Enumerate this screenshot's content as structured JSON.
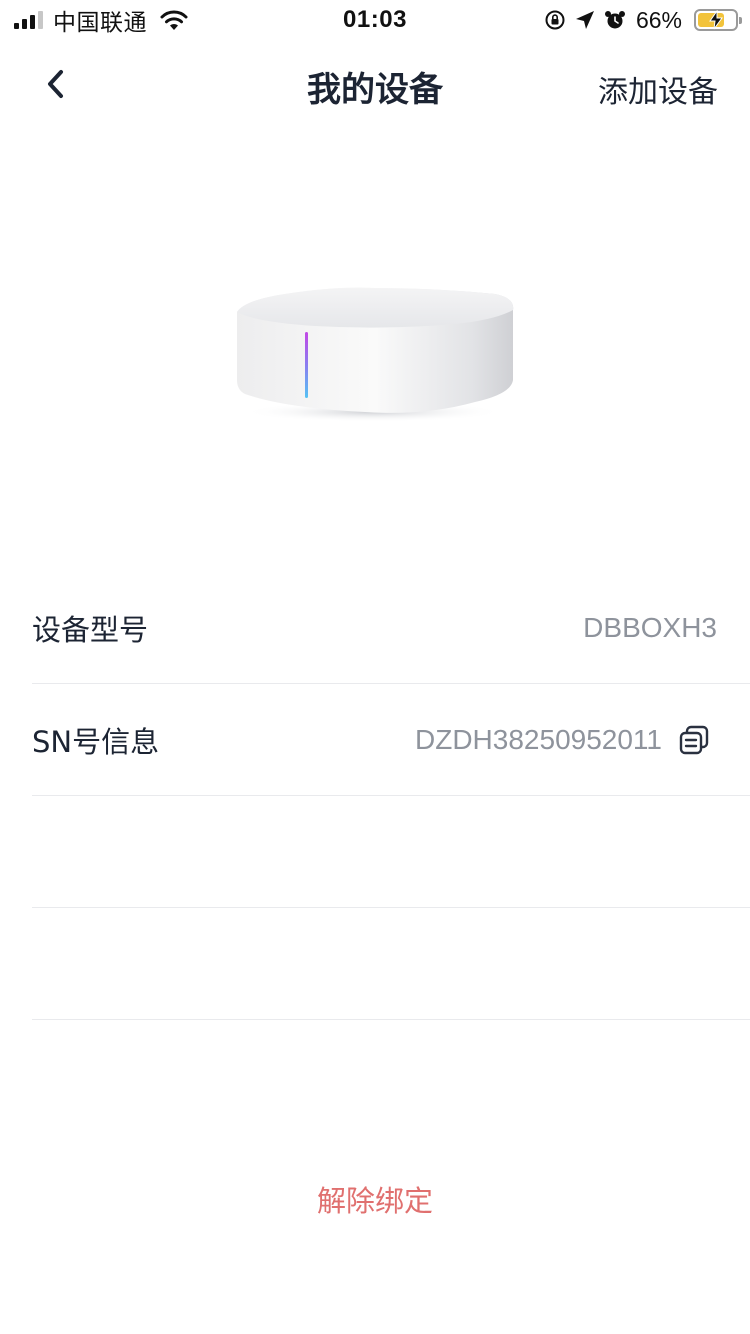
{
  "status_bar": {
    "carrier": "中国联通",
    "time": "01:03",
    "battery_percent": "66%",
    "icons": [
      "signal-icon",
      "wifi-icon",
      "orientation-lock-icon",
      "location-icon",
      "alarm-icon",
      "battery-charging-icon"
    ]
  },
  "nav": {
    "back_icon": "chevron-left-icon",
    "title": "我的设备",
    "add_device": "添加设备"
  },
  "device": {
    "image": "smart-home-hub-box"
  },
  "info": {
    "model_label": "设备型号",
    "model_value": "DBBOXH3",
    "sn_label": "SN号信息",
    "sn_value": "DZDH38250952011",
    "copy_icon": "copy-icon"
  },
  "actions": {
    "unbind": "解除绑定"
  },
  "colors": {
    "primary_text": "#1c2433",
    "secondary_text": "#8e939c",
    "danger": "#e0706f",
    "divider": "#e9eaed",
    "battery": "#f2c33b"
  }
}
